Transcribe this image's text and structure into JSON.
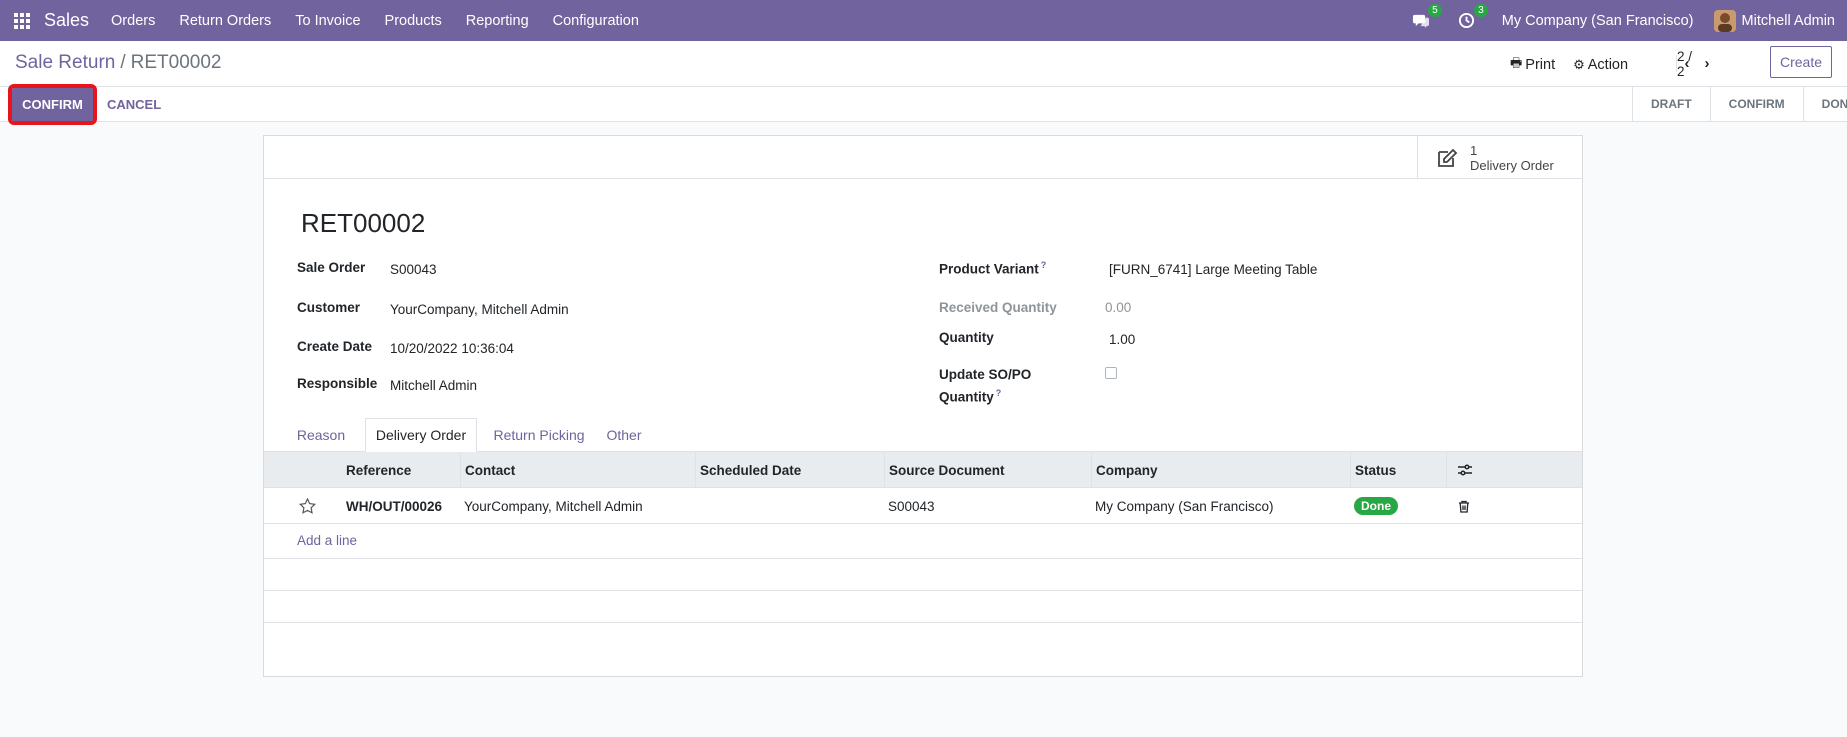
{
  "nav": {
    "app_name": "Sales",
    "menu": [
      "Orders",
      "Return Orders",
      "To Invoice",
      "Products",
      "Reporting",
      "Configuration"
    ],
    "messages_count": "5",
    "activities_count": "3",
    "company": "My Company (San Francisco)",
    "user": "Mitchell Admin"
  },
  "control_panel": {
    "breadcrumb_parent": "Sale Return",
    "breadcrumb_sep": "/",
    "breadcrumb_current": "RET00002",
    "print_label": "Print",
    "action_label": "Action",
    "pager_value": "2 / 2",
    "create_label": "Create"
  },
  "statusbar": {
    "confirm_label": "CONFIRM",
    "cancel_label": "CANCEL",
    "stages": [
      "DRAFT",
      "CONFIRM",
      "DONE"
    ]
  },
  "smart_button": {
    "count": "1",
    "label": "Delivery Order"
  },
  "record": {
    "name": "RET00002",
    "sale_order_label": "Sale Order",
    "sale_order": "S00043",
    "customer_label": "Customer",
    "customer": "YourCompany, Mitchell Admin",
    "create_date_label": "Create Date",
    "create_date": "10/20/2022 10:36:04",
    "responsible_label": "Responsible",
    "responsible": "Mitchell Admin",
    "product_variant_label": "Product Variant",
    "product_variant": "[FURN_6741] Large Meeting Table",
    "received_qty_label": "Received Quantity",
    "received_qty": "0.00",
    "quantity_label": "Quantity",
    "quantity": "1.00",
    "update_qty_label_1": "Update SO/PO",
    "update_qty_label_2": "Quantity",
    "help_mark": "?"
  },
  "tabs": [
    "Reason",
    "Delivery Order",
    "Return Picking",
    "Other"
  ],
  "table": {
    "columns": [
      "Reference",
      "Contact",
      "Scheduled Date",
      "Source Document",
      "Company",
      "Status"
    ],
    "rows": [
      {
        "reference": "WH/OUT/00026",
        "contact": "YourCompany, Mitchell Admin",
        "scheduled_date": "",
        "source_document": "S00043",
        "company": "My Company (San Francisco)",
        "status": "Done"
      }
    ],
    "add_line_label": "Add a line"
  },
  "colors": {
    "brand": "#71639e",
    "highlight": "#e8141c",
    "done": "#28a745"
  }
}
